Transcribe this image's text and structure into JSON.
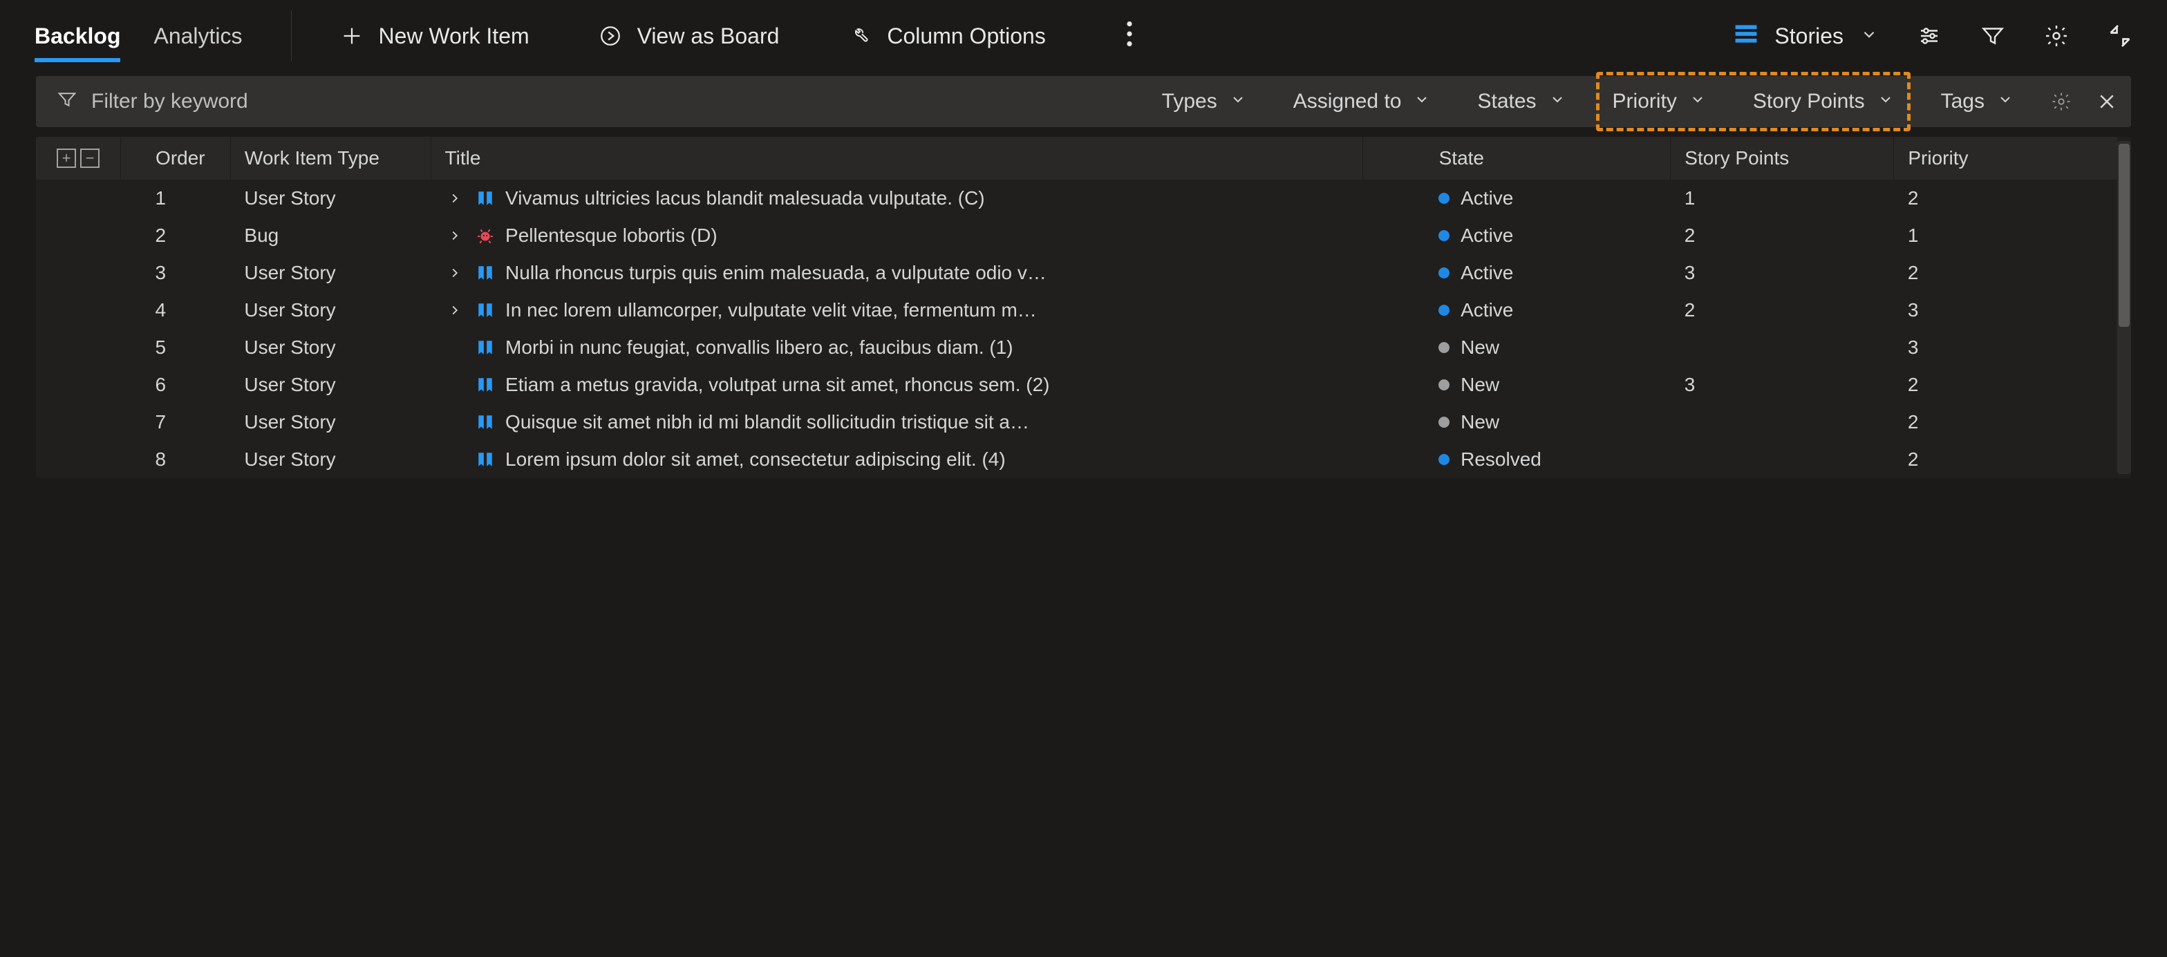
{
  "tabs": {
    "backlog": "Backlog",
    "analytics": "Analytics"
  },
  "actions": {
    "new_work_item": "New Work Item",
    "view_as_board": "View as Board",
    "column_options": "Column Options"
  },
  "view_picker": {
    "label": "Stories"
  },
  "filter": {
    "placeholder": "Filter by keyword",
    "types": "Types",
    "assigned_to": "Assigned to",
    "states": "States",
    "priority": "Priority",
    "story_points": "Story Points",
    "tags": "Tags"
  },
  "columns": {
    "order": "Order",
    "work_item_type": "Work Item Type",
    "title": "Title",
    "state": "State",
    "story_points": "Story Points",
    "priority": "Priority"
  },
  "state_labels": {
    "active": "Active",
    "new": "New",
    "resolved": "Resolved"
  },
  "icon_colors": {
    "story": "#2899f5",
    "bug": "#e74856",
    "stories_view": "#2899f5"
  },
  "rows": [
    {
      "order": "1",
      "type": "User Story",
      "kind": "story",
      "expandable": true,
      "title": "Vivamus ultricies lacus blandit malesuada vulputate. (C)",
      "state": "active",
      "sp": "1",
      "prio": "2"
    },
    {
      "order": "2",
      "type": "Bug",
      "kind": "bug",
      "expandable": true,
      "title": "Pellentesque lobortis (D)",
      "state": "active",
      "sp": "2",
      "prio": "1"
    },
    {
      "order": "3",
      "type": "User Story",
      "kind": "story",
      "expandable": true,
      "title": "Nulla rhoncus turpis quis enim malesuada, a vulputate odio v…",
      "state": "active",
      "sp": "3",
      "prio": "2"
    },
    {
      "order": "4",
      "type": "User Story",
      "kind": "story",
      "expandable": true,
      "title": "In nec lorem ullamcorper, vulputate velit vitae, fermentum m…",
      "state": "active",
      "sp": "2",
      "prio": "3"
    },
    {
      "order": "5",
      "type": "User Story",
      "kind": "story",
      "expandable": false,
      "title": "Morbi in nunc feugiat, convallis libero ac, faucibus diam. (1)",
      "state": "new",
      "sp": "",
      "prio": "3"
    },
    {
      "order": "6",
      "type": "User Story",
      "kind": "story",
      "expandable": false,
      "title": "Etiam a metus gravida, volutpat urna sit amet, rhoncus sem. (2)",
      "state": "new",
      "sp": "3",
      "prio": "2"
    },
    {
      "order": "7",
      "type": "User Story",
      "kind": "story",
      "expandable": false,
      "title": "Quisque sit amet nibh id mi blandit sollicitudin tristique sit a…",
      "state": "new",
      "sp": "",
      "prio": "2"
    },
    {
      "order": "8",
      "type": "User Story",
      "kind": "story",
      "expandable": false,
      "title": "Lorem ipsum dolor sit amet, consectetur adipiscing elit. (4)",
      "state": "resolved",
      "sp": "",
      "prio": "2"
    }
  ]
}
